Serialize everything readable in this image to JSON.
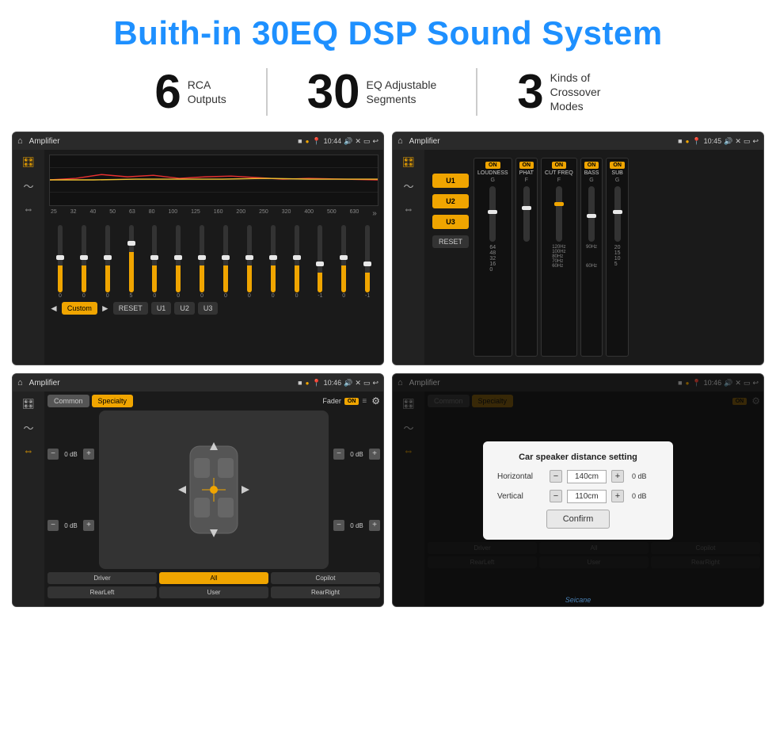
{
  "header": {
    "title": "Buith-in 30EQ DSP Sound System"
  },
  "stats": [
    {
      "number": "6",
      "label": "RCA\nOutputs"
    },
    {
      "number": "30",
      "label": "EQ Adjustable\nSegments"
    },
    {
      "number": "3",
      "label": "Kinds of\nCrossover Modes"
    }
  ],
  "screens": {
    "eq_screen": {
      "time": "10:44",
      "title": "Amplifier",
      "bands": [
        "25",
        "32",
        "40",
        "50",
        "63",
        "80",
        "100",
        "125",
        "160",
        "200",
        "250",
        "320",
        "400",
        "500",
        "630"
      ],
      "values": [
        "0",
        "0",
        "0",
        "5",
        "0",
        "0",
        "0",
        "0",
        "0",
        "0",
        "0",
        "-1",
        "0",
        "-1"
      ],
      "bottom_buttons": [
        "◄",
        "Custom",
        "►",
        "RESET",
        "U1",
        "U2",
        "U3"
      ]
    },
    "amp_screen": {
      "time": "10:45",
      "title": "Amplifier",
      "u_buttons": [
        "U1",
        "U2",
        "U3"
      ],
      "channels": [
        {
          "name": "LOUDNESS",
          "on": true
        },
        {
          "name": "PHAT",
          "on": true
        },
        {
          "name": "CUT FREQ",
          "on": true
        },
        {
          "name": "BASS",
          "on": true
        },
        {
          "name": "SUB",
          "on": true
        }
      ]
    },
    "fader_screen": {
      "time": "10:46",
      "title": "Amplifier",
      "tabs": [
        "Common",
        "Specialty"
      ],
      "fader_label": "Fader",
      "fader_on": "ON",
      "speaker_positions": [
        "Driver",
        "RearLeft",
        "All",
        "User",
        "RearRight",
        "Copilot"
      ],
      "db_controls": [
        {
          "label": "0 dB"
        },
        {
          "label": "0 dB"
        },
        {
          "label": "0 dB"
        },
        {
          "label": "0 dB"
        }
      ]
    },
    "distance_screen": {
      "time": "10:46",
      "title": "Amplifier",
      "modal": {
        "title": "Car speaker distance setting",
        "horizontal_label": "Horizontal",
        "horizontal_value": "140cm",
        "vertical_label": "Vertical",
        "vertical_value": "110cm",
        "confirm_label": "Confirm",
        "db_label": "0 dB"
      },
      "speaker_positions": [
        "Driver",
        "RearLeft",
        "All",
        "User",
        "RearRight",
        "Copilot"
      ]
    }
  },
  "watermark": "Seicane"
}
